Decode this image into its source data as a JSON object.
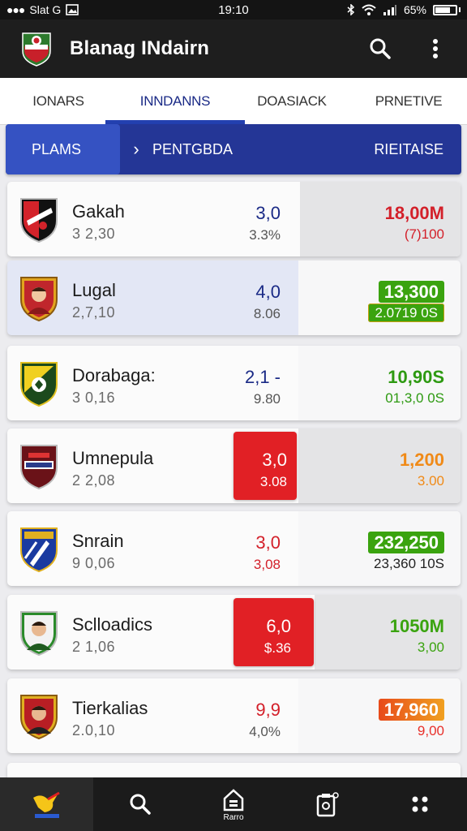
{
  "status": {
    "carrier": "Slat G",
    "time": "19:10",
    "battery": "65%"
  },
  "app": {
    "title": "Blanag INdairn"
  },
  "tabs": [
    {
      "label": "IONARS"
    },
    {
      "label": "INNDANNS"
    },
    {
      "label": "DOASIACK"
    },
    {
      "label": "PRNETIVE"
    }
  ],
  "filter": {
    "first": "PLAMS",
    "second": "PENTGBDA",
    "third": "RIEITAISE"
  },
  "rows": [
    {
      "name": "Gakah",
      "sub": "3 2,30",
      "value": "3,0",
      "value_sub": "3.3%",
      "amount": "18,00M",
      "amount_sub": "(7)100"
    },
    {
      "name": "Lugal",
      "sub": "2,7,10",
      "value": "4,0",
      "value_sub": "8.06",
      "amount": "13,300",
      "amount_sub": "2.0719 0S"
    },
    {
      "name": "Dorabaga:",
      "sub": "3 0,16",
      "value": "2,1 -",
      "value_sub": "9.80",
      "amount": "10,90S",
      "amount_sub": "01,3,0 0S"
    },
    {
      "name": "Umnepula",
      "sub": "2 2,08",
      "value": "3,0",
      "value_sub": "3.08",
      "amount": "1,200",
      "amount_sub": "3.00"
    },
    {
      "name": "Snrain",
      "sub": "9 0,06",
      "value": "3,0",
      "value_sub": "3,08",
      "amount": "232,250",
      "amount_sub": "23,360 10S"
    },
    {
      "name": "Sclloadics",
      "sub": "2 1,06",
      "value": "6,0",
      "value_sub": "$.36",
      "amount": "1050M",
      "amount_sub": "3,00"
    },
    {
      "name": "Tierkalias",
      "sub": "2.0,10",
      "value": "9,9",
      "value_sub": "4,0%",
      "amount": "17,960",
      "amount_sub": "9,00"
    }
  ],
  "bottom_nav": [
    {
      "icon": "bird-icon",
      "label": ""
    },
    {
      "icon": "search-icon",
      "label": ""
    },
    {
      "icon": "home-icon",
      "label": "Rarro"
    },
    {
      "icon": "clipboard-icon",
      "label": ""
    },
    {
      "icon": "grid-icon",
      "label": ""
    }
  ],
  "colors": {
    "primary": "#243696",
    "accent": "#3552c2",
    "red": "#e12025",
    "green": "#3aa30f",
    "orange": "#f08a18",
    "navy": "#1a2a86"
  }
}
